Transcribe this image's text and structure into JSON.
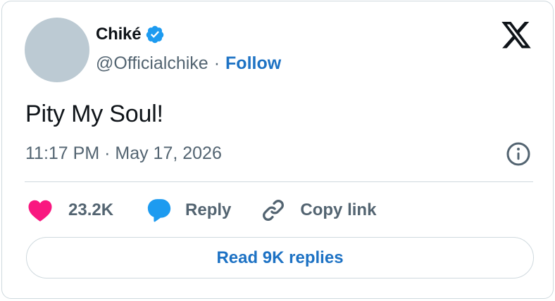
{
  "author": {
    "display_name": "Chiké",
    "handle": "@Officialchike",
    "separator": "·",
    "follow_label": "Follow",
    "verified": true
  },
  "tweet": {
    "text": "Pity My Soul!",
    "timestamp": "11:17 PM · May 17, 2026"
  },
  "actions": {
    "likes_count": "23.2K",
    "reply_label": "Reply",
    "copy_link_label": "Copy link"
  },
  "footer": {
    "read_replies_label": "Read 9K replies"
  },
  "colors": {
    "accent": "#1d72c4",
    "verified_badge": "#1d9bf0",
    "like_heart": "#f91880",
    "reply_bubble": "#1d9bf0",
    "muted_text": "#536471",
    "avatar_placeholder": "#bccad3",
    "border": "#cfd9de"
  },
  "icons": [
    "verified-badge-icon",
    "x-logo-icon",
    "info-icon",
    "heart-icon",
    "reply-bubble-icon",
    "link-icon"
  ]
}
